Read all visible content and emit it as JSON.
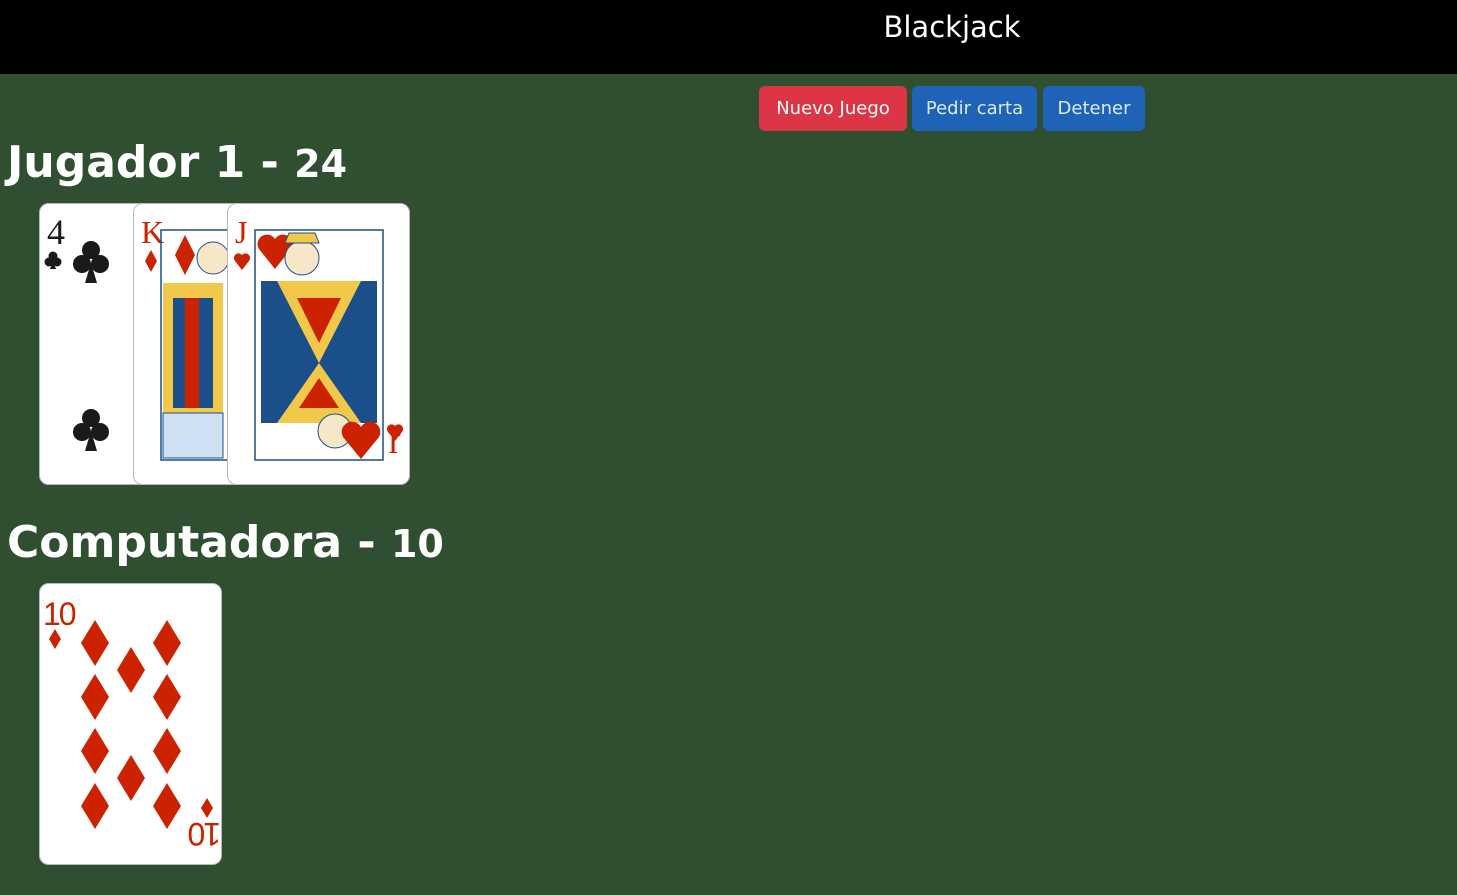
{
  "header": {
    "title": "Blackjack"
  },
  "buttons": {
    "new_game": "Nuevo Juego",
    "hit": "Pedir carta",
    "stop": "Detener"
  },
  "player": {
    "label": "Jugador 1 -",
    "score": "24",
    "cards": [
      {
        "rank": "4",
        "suit": "clubs",
        "color": "#1a1a1a"
      },
      {
        "rank": "K",
        "suit": "diamonds",
        "color": "#cc2200"
      },
      {
        "rank": "J",
        "suit": "hearts",
        "color": "#cc2200"
      }
    ]
  },
  "computer": {
    "label": "Computadora -",
    "score": "10",
    "cards": [
      {
        "rank": "10",
        "suit": "diamonds",
        "color": "#cc2200"
      }
    ]
  },
  "colors": {
    "table": "#304f31",
    "topbar": "#000000",
    "danger": "#dc3545",
    "primary": "#1e63b8"
  }
}
